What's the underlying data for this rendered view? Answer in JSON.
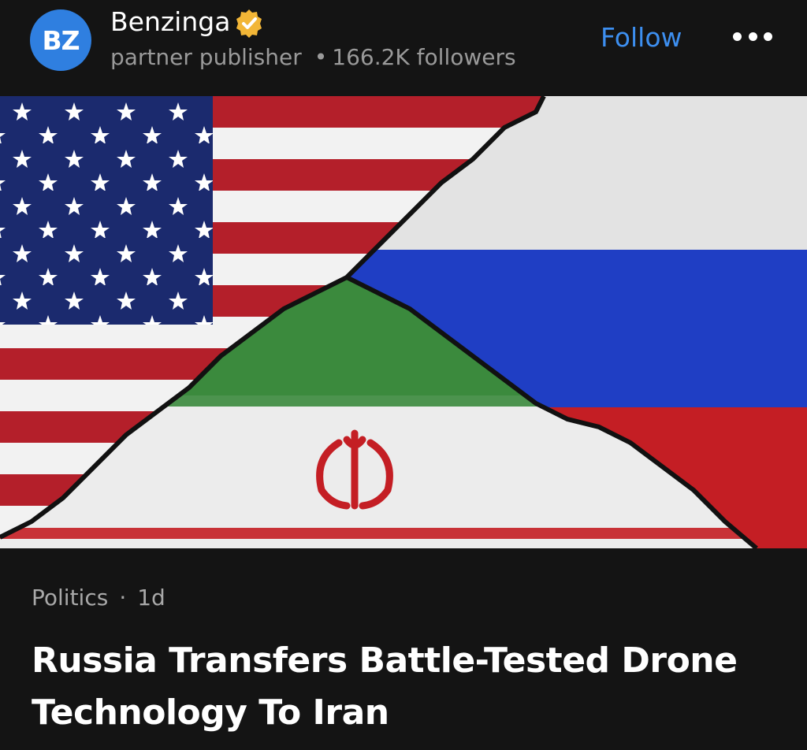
{
  "publisher": {
    "avatar_text": "BZ",
    "name": "Benzinga",
    "subtitle": "partner publisher",
    "separator": "•",
    "followers": "166.2K followers",
    "verified_icon": "verified-badge-icon",
    "avatar_color": "#2f7fe0"
  },
  "actions": {
    "follow_label": "Follow",
    "follow_color": "#3d8ff0",
    "more_icon": "more-dots-icon"
  },
  "article": {
    "category": "Politics",
    "separator": "·",
    "age": "1d",
    "title": "Russia Transfers Battle-Tested Drone Technology To Iran"
  },
  "image": {
    "description_icon": "flags-image",
    "colors": {
      "us_red": "#b41f2a",
      "us_blue": "#1b2a6e",
      "iran_green": "#3b8a3d",
      "russia_blue": "#1f3ec4",
      "russia_red": "#c41e24",
      "cracked_white": "#dcdcdc"
    }
  }
}
